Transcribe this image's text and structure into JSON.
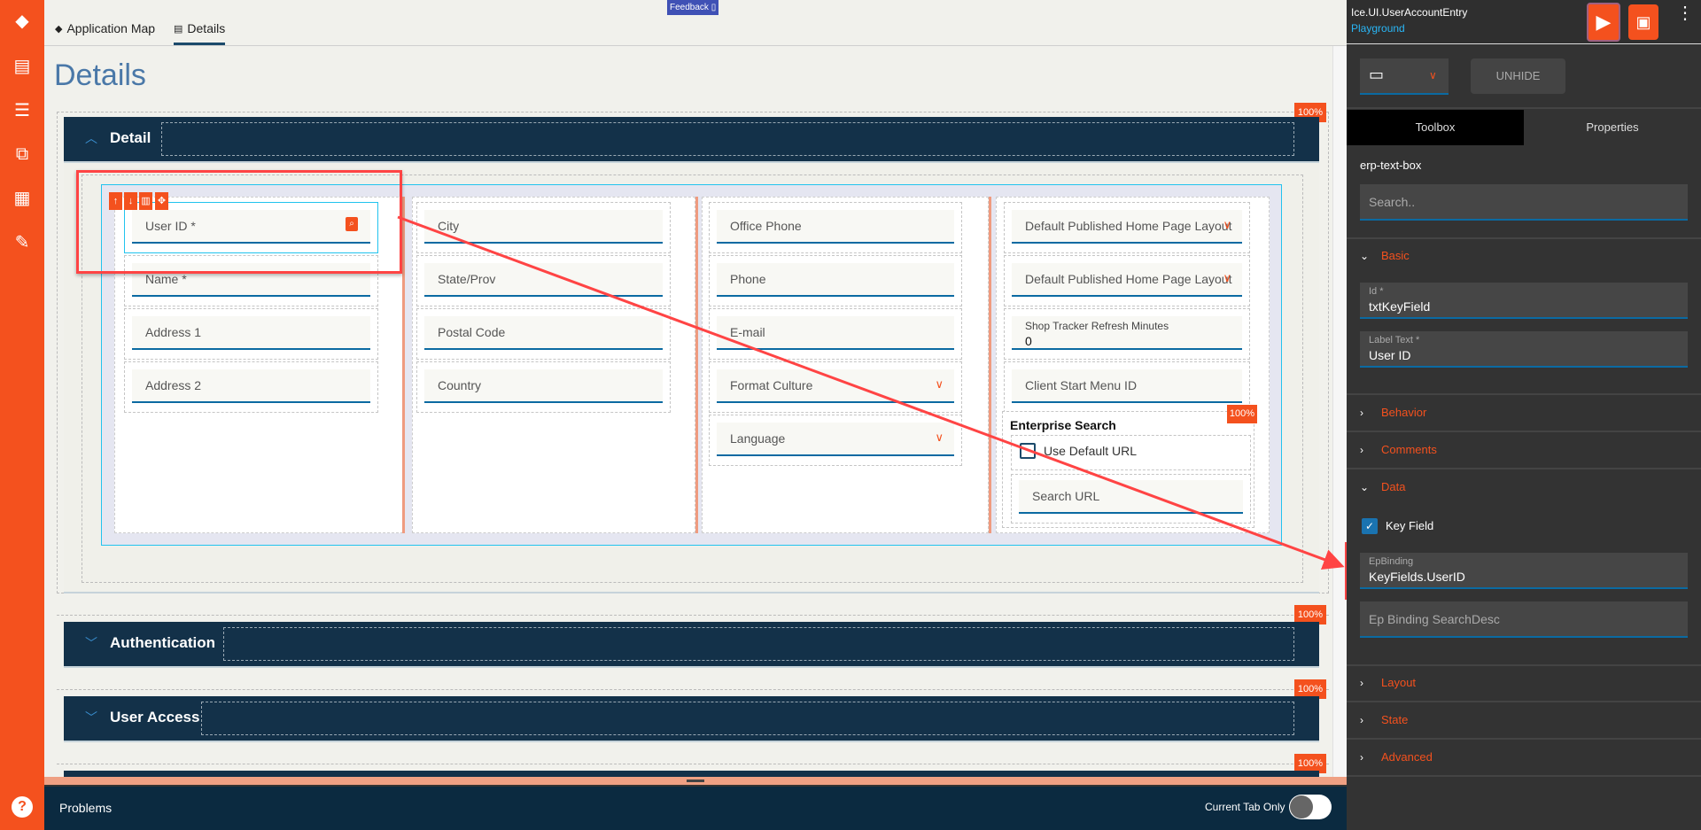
{
  "sidebar": {
    "icons": [
      "layers-icon",
      "layout-icon",
      "checklist-icon",
      "flow-icon",
      "grid-icon",
      "edit-doc-icon"
    ],
    "help": "?"
  },
  "tabs": [
    {
      "label": "Application Map"
    },
    {
      "label": "Details"
    }
  ],
  "feedback": "Feedback",
  "page_title": "Details",
  "sections": [
    {
      "label": "Detail",
      "badge": "100%"
    },
    {
      "label": "Authentication",
      "badge": "100%"
    },
    {
      "label": "User Access",
      "badge": "100%"
    },
    {
      "badge": "100%"
    }
  ],
  "form": {
    "col1": [
      {
        "label": "User ID *",
        "search": true,
        "selected": true
      },
      {
        "label": "Name *"
      },
      {
        "label": "Address 1"
      },
      {
        "label": "Address 2"
      }
    ],
    "col2": [
      {
        "label": "City"
      },
      {
        "label": "State/Prov"
      },
      {
        "label": "Postal Code"
      },
      {
        "label": "Country"
      }
    ],
    "col3": [
      {
        "label": "Office Phone"
      },
      {
        "label": "Phone"
      },
      {
        "label": "E-mail"
      },
      {
        "label": "Format Culture",
        "dropdown": true
      },
      {
        "label": "Language",
        "dropdown": true
      }
    ],
    "col4": [
      {
        "label": "Default Published Home Page Layout",
        "dropdown": true
      },
      {
        "label": "Default Published Home Page Layout",
        "dropdown": true
      },
      {
        "small_label": "Shop Tracker Refresh Minutes",
        "value": "0"
      },
      {
        "label": "Client Start Menu ID"
      }
    ],
    "enterprise_search": {
      "title": "Enterprise Search",
      "badge": "100%",
      "checkbox_label": "Use Default URL",
      "checked": false,
      "search_url": "Search URL"
    }
  },
  "bottom": {
    "problems": "Problems",
    "current_tab_only": "Current Tab Only",
    "toggle_on": false
  },
  "right": {
    "app_name": "Ice.UI.UserAccountEntry",
    "env": "Playground",
    "unhide": "UNHIDE",
    "tabs": [
      "Toolbox",
      "Properties"
    ],
    "component": "erp-text-box",
    "search_placeholder": "Search..",
    "groups": {
      "basic": "Basic",
      "behavior": "Behavior",
      "comments": "Comments",
      "data": "Data",
      "layout": "Layout",
      "state": "State",
      "advanced": "Advanced"
    },
    "id_label": "Id *",
    "id_value": "txtKeyField",
    "labeltext_label": "Label Text *",
    "labeltext_value": "User ID",
    "keyfield_label": "Key Field",
    "keyfield_checked": true,
    "epbinding_label": "EpBinding",
    "epbinding_value": "KeyFields.UserID",
    "epbinding_searchdesc_placeholder": "Ep Binding SearchDesc"
  },
  "colors": {
    "accent": "#f4511e",
    "header": "#133149",
    "link": "#29b6f6"
  }
}
